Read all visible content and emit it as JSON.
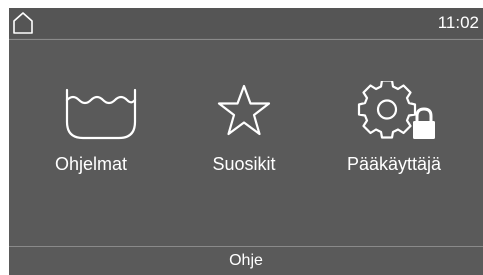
{
  "status_bar": {
    "time": "11:02",
    "home_icon": "home-icon"
  },
  "menu": [
    {
      "label": "Ohjelmat",
      "icon": "wash-basin-icon"
    },
    {
      "label": "Suosikit",
      "icon": "star-icon"
    },
    {
      "label": "Pääkäyttäjä",
      "icon": "gear-lock-icon"
    }
  ],
  "footer": {
    "help_label": "Ohje"
  },
  "colors": {
    "screen_bg": "#5a5a5a",
    "foreground": "#ffffff"
  }
}
